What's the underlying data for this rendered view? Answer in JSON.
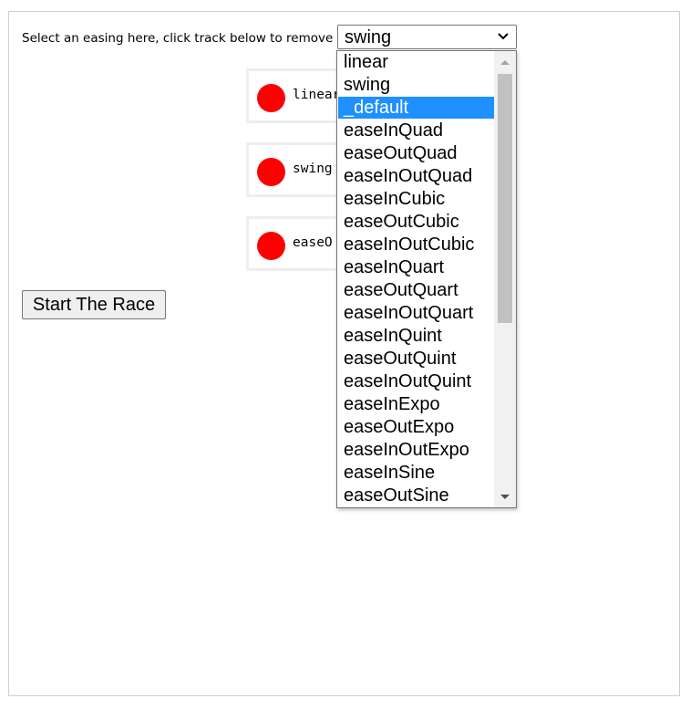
{
  "instruction": "Select an easing here, click track below to remove",
  "easing_select": {
    "value": "swing",
    "options": [
      "linear",
      "swing",
      "_default",
      "easeInQuad",
      "easeOutQuad",
      "easeInOutQuad",
      "easeInCubic",
      "easeOutCubic",
      "easeInOutCubic",
      "easeInQuart",
      "easeOutQuart",
      "easeInOutQuart",
      "easeInQuint",
      "easeOutQuint",
      "easeInOutQuint",
      "easeInExpo",
      "easeOutExpo",
      "easeInOutExpo",
      "easeInSine",
      "easeOutSine"
    ],
    "highlighted": "_default"
  },
  "tracks": [
    {
      "label": "linear"
    },
    {
      "label": "swing"
    },
    {
      "label": "easeO"
    }
  ],
  "start_button": {
    "label": "Start The Race"
  },
  "colors": {
    "ball": "#ff0000",
    "highlight": "#1e90ff",
    "track_border": "#eeeeee",
    "frame_border": "#cfcfcf"
  }
}
